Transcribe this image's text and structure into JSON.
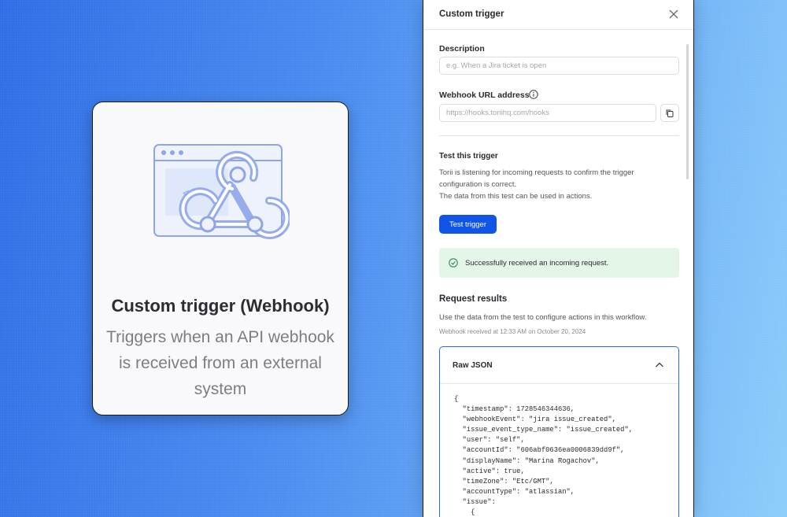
{
  "card": {
    "title": "Custom trigger (Webhook)",
    "description": "Triggers when an API webhook is received from an external system",
    "code_glyph": "</>"
  },
  "panel": {
    "title": "Custom trigger",
    "description_label": "Description",
    "description_placeholder": "e.g. When a Jira ticket is open",
    "webhook_label": "Webhook URL address",
    "webhook_value": "https://hooks.toriihq.com/hooks",
    "test_title": "Test this trigger",
    "test_text_1": "Torii is listening for incoming requests to confirm the trigger configuration is correct.",
    "test_text_2": "The data from this test can be used in actions.",
    "test_button": "Test trigger",
    "success_message": "Successfully received an incoming request.",
    "results_title": "Request results",
    "results_text": "Use the data from the test to configure actions in this workflow.",
    "received_text": "Webhook received at 12:33 AM on October 20, 2024",
    "json_title": "Raw JSON",
    "json_lines": [
      "{",
      "  \"timestamp\": 1728546344636,",
      "  \"webhookEvent\": \"jira issue_created\",",
      "  \"issue_event_type_name\": \"issue_created\",",
      "  \"user\": \"self\",",
      "  \"accountId\": \"606abf0636ea0006839dd9f\",",
      "  \"displayName\": \"Marina Rogachov\",",
      "  \"active\": true,",
      "  \"timeZone\": \"Etc/GMT\",",
      "  \"accountType\": \"atlassian\",",
      "  \"issue\":",
      "    {"
    ]
  },
  "colors": {
    "accent": "#1155e8",
    "success_bg": "#e3f6e8",
    "success_icon": "#2e8b57",
    "illustration": "#8ea5ea"
  },
  "icons": [
    "webhook-illustration",
    "close-icon",
    "info-icon",
    "copy-icon",
    "check-circle-icon",
    "chevron-up-icon"
  ]
}
